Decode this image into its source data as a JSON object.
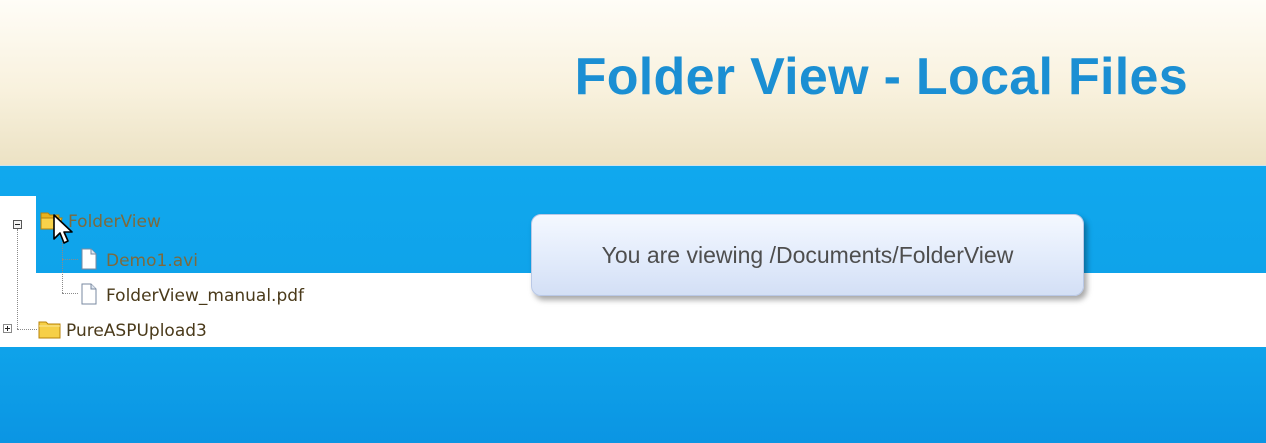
{
  "header": {
    "title": "Folder View - Local Files"
  },
  "tree": {
    "root": {
      "label": "FolderView",
      "icon": "open-folder-icon",
      "expanded": true,
      "children": [
        {
          "label": "Demo1.avi",
          "icon": "file-icon"
        },
        {
          "label": "FolderView_manual.pdf",
          "icon": "file-icon"
        }
      ]
    },
    "second": {
      "label": "PureASPUpload3",
      "icon": "folder-icon",
      "expanded": false
    }
  },
  "tooltip": {
    "text": "You are viewing /Documents/FolderView"
  },
  "colors": {
    "title_blue": "#1b8fd3",
    "band_blue": "#10a8ee",
    "header_cream": "#f8f1dd"
  }
}
